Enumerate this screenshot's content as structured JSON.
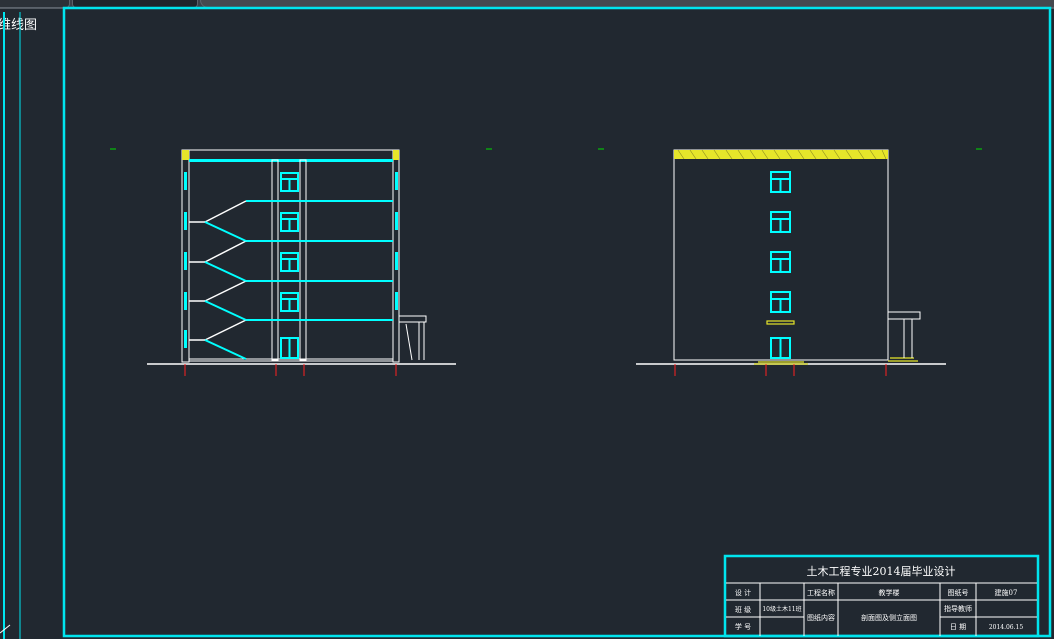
{
  "viewport": {
    "label": "维线图"
  },
  "title_block": {
    "title": "土木工程专业2014届毕业设计",
    "rows": [
      {
        "c1": "设 计",
        "c2": "",
        "c3": "工程名称",
        "c4": "教学楼",
        "c5": "图纸号",
        "c6": "建施07"
      },
      {
        "c1": "班 级",
        "c2": "10级土木11班",
        "c3": "图纸内容",
        "c4": "剖面图及侧立面图",
        "c5": "指导教师",
        "c6": ""
      },
      {
        "c1": "学 号",
        "c2": "",
        "c3": "",
        "c4": "",
        "c5": "日 期",
        "c6": "2014.06.15"
      }
    ]
  },
  "colors": {
    "background": "#212830",
    "frame": "#00e5ee",
    "linework": "#ffffff",
    "windows": "#00ffff",
    "hatch": "#ffff33",
    "axis_marks": "#ff2020"
  }
}
